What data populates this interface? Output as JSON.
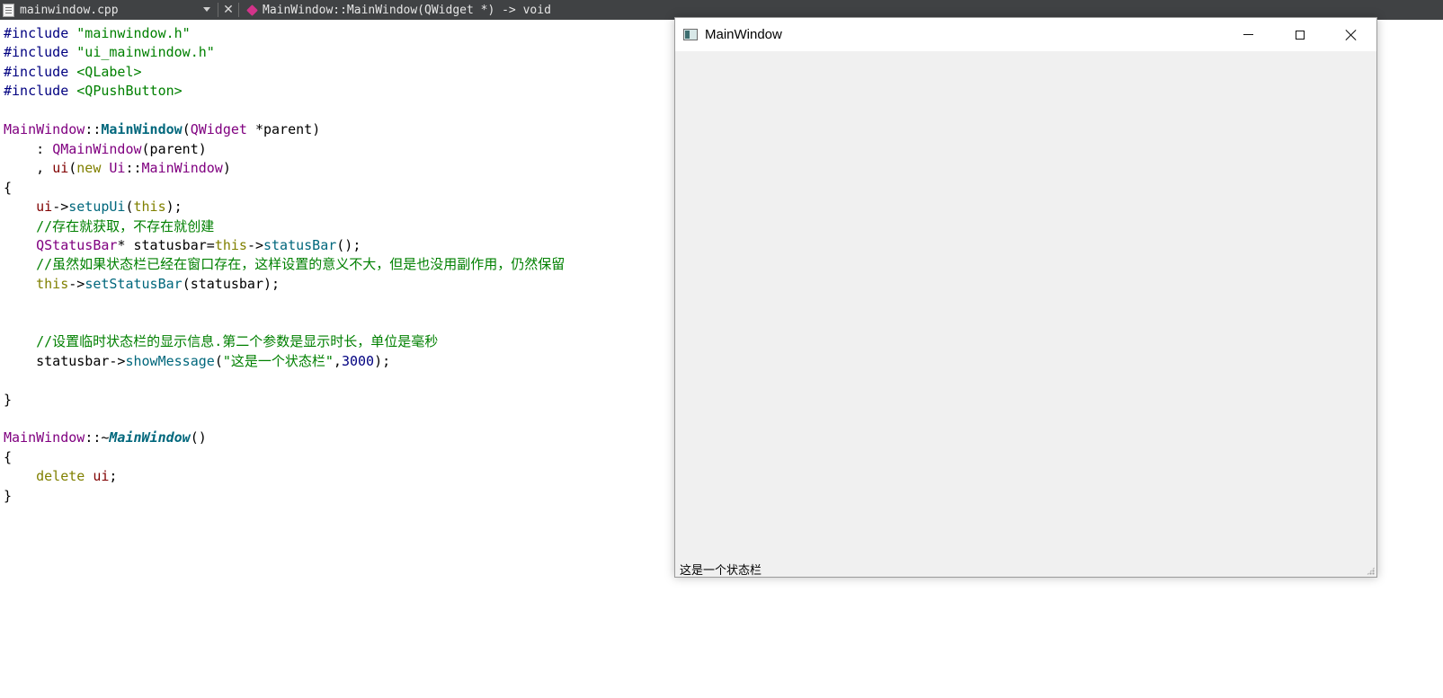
{
  "editor": {
    "toolbar": {
      "file_name": "mainwindow.cpp",
      "close_glyph": "✕",
      "symbol": "MainWindow::MainWindow(QWidget *) -> void"
    },
    "code": {
      "lines": [
        [
          {
            "t": "pre",
            "s": "#include "
          },
          {
            "t": "str",
            "s": "\"mainwindow.h\""
          }
        ],
        [
          {
            "t": "pre",
            "s": "#include "
          },
          {
            "t": "str",
            "s": "\"ui_mainwindow.h\""
          }
        ],
        [
          {
            "t": "pre",
            "s": "#include "
          },
          {
            "t": "str",
            "s": "<QLabel>"
          }
        ],
        [
          {
            "t": "pre",
            "s": "#include "
          },
          {
            "t": "str",
            "s": "<QPushButton>"
          }
        ],
        [],
        [
          {
            "t": "cls",
            "s": "MainWindow"
          },
          {
            "t": "plain",
            "s": "::"
          },
          {
            "t": "fn",
            "s": "MainWindow"
          },
          {
            "t": "plain",
            "s": "("
          },
          {
            "t": "cls",
            "s": "QWidget"
          },
          {
            "t": "plain",
            "s": " *"
          },
          {
            "t": "plain",
            "s": "parent"
          },
          {
            "t": "plain",
            "s": ")"
          }
        ],
        [
          {
            "t": "plain",
            "s": "    : "
          },
          {
            "t": "cls",
            "s": "QMainWindow"
          },
          {
            "t": "plain",
            "s": "(parent)"
          }
        ],
        [
          {
            "t": "plain",
            "s": "    , "
          },
          {
            "t": "mem",
            "s": "ui"
          },
          {
            "t": "plain",
            "s": "("
          },
          {
            "t": "kw",
            "s": "new"
          },
          {
            "t": "plain",
            "s": " "
          },
          {
            "t": "cls",
            "s": "Ui"
          },
          {
            "t": "plain",
            "s": "::"
          },
          {
            "t": "cls",
            "s": "MainWindow"
          },
          {
            "t": "plain",
            "s": ")"
          }
        ],
        [
          {
            "t": "plain",
            "s": "{"
          }
        ],
        [
          {
            "t": "plain",
            "s": "    "
          },
          {
            "t": "mem",
            "s": "ui"
          },
          {
            "t": "plain",
            "s": "->"
          },
          {
            "t": "call",
            "s": "setupUi"
          },
          {
            "t": "plain",
            "s": "("
          },
          {
            "t": "kw",
            "s": "this"
          },
          {
            "t": "plain",
            "s": ");"
          }
        ],
        [
          {
            "t": "plain",
            "s": "    "
          },
          {
            "t": "cmt",
            "s": "//存在就获取，不存在就创建"
          }
        ],
        [
          {
            "t": "plain",
            "s": "    "
          },
          {
            "t": "cls",
            "s": "QStatusBar"
          },
          {
            "t": "plain",
            "s": "* statusbar="
          },
          {
            "t": "kw",
            "s": "this"
          },
          {
            "t": "plain",
            "s": "->"
          },
          {
            "t": "call",
            "s": "statusBar"
          },
          {
            "t": "plain",
            "s": "();"
          }
        ],
        [
          {
            "t": "plain",
            "s": "    "
          },
          {
            "t": "cmt",
            "s": "//虽然如果状态栏已经在窗口存在，这样设置的意义不大，但是也没用副作用，仍然保留"
          }
        ],
        [
          {
            "t": "plain",
            "s": "    "
          },
          {
            "t": "kw",
            "s": "this"
          },
          {
            "t": "plain",
            "s": "->"
          },
          {
            "t": "call",
            "s": "setStatusBar"
          },
          {
            "t": "plain",
            "s": "(statusbar);"
          }
        ],
        [],
        [],
        [
          {
            "t": "plain",
            "s": "    "
          },
          {
            "t": "cmt",
            "s": "//设置临时状态栏的显示信息.第二个参数是显示时长，单位是毫秒"
          }
        ],
        [
          {
            "t": "plain",
            "s": "    statusbar->"
          },
          {
            "t": "call",
            "s": "showMessage"
          },
          {
            "t": "plain",
            "s": "("
          },
          {
            "t": "str",
            "s": "\"这是一个状态栏\""
          },
          {
            "t": "plain",
            "s": ","
          },
          {
            "t": "num",
            "s": "3000"
          },
          {
            "t": "plain",
            "s": ");"
          }
        ],
        [],
        [
          {
            "t": "plain",
            "s": "}"
          }
        ],
        [],
        [
          {
            "t": "cls",
            "s": "MainWindow"
          },
          {
            "t": "plain",
            "s": "::~"
          },
          {
            "t": "fni",
            "s": "MainWindow"
          },
          {
            "t": "plain",
            "s": "()"
          }
        ],
        [
          {
            "t": "plain",
            "s": "{"
          }
        ],
        [
          {
            "t": "plain",
            "s": "    "
          },
          {
            "t": "kw",
            "s": "delete"
          },
          {
            "t": "plain",
            "s": " "
          },
          {
            "t": "mem",
            "s": "ui"
          },
          {
            "t": "plain",
            "s": ";"
          }
        ],
        [
          {
            "t": "plain",
            "s": "}"
          }
        ]
      ]
    }
  },
  "window": {
    "title": "MainWindow",
    "icon": "qt-window-icon",
    "controls": {
      "minimize": "minimize-icon",
      "maximize": "maximize-icon",
      "close": "close-icon"
    },
    "status_bar": {
      "message": "这是一个状态栏"
    }
  }
}
